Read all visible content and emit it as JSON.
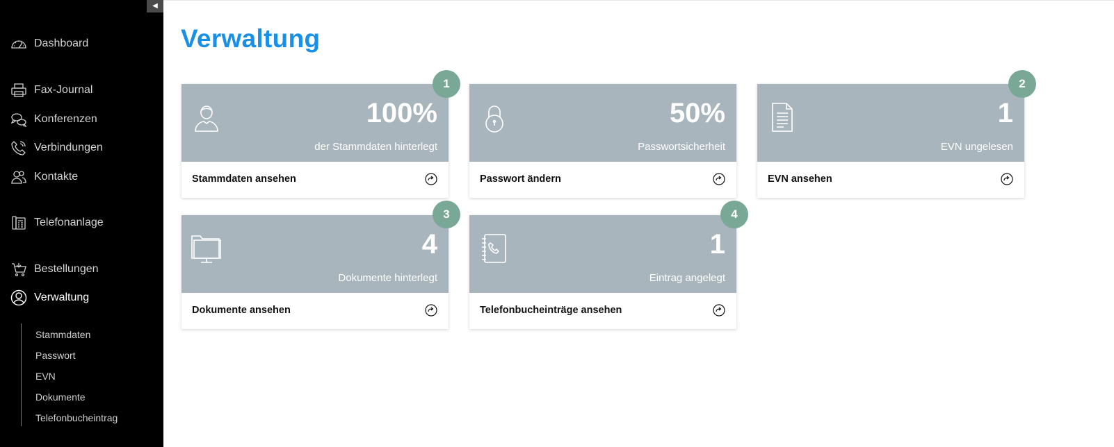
{
  "sidebar": {
    "collapse_glyph": "◀",
    "items": [
      {
        "label": "Dashboard",
        "icon": "speedometer-icon"
      },
      {
        "label": "Fax-Journal",
        "icon": "printer-icon"
      },
      {
        "label": "Konferenzen",
        "icon": "chat-bubbles-icon"
      },
      {
        "label": "Verbindungen",
        "icon": "phone-icon"
      },
      {
        "label": "Kontakte",
        "icon": "people-icon"
      },
      {
        "label": "Telefonanlage",
        "icon": "desk-phone-icon"
      },
      {
        "label": "Bestellungen",
        "icon": "cart-icon"
      },
      {
        "label": "Verwaltung",
        "icon": "user-circle-icon",
        "active": true
      }
    ],
    "subitems": [
      {
        "label": "Stammdaten"
      },
      {
        "label": "Passwort"
      },
      {
        "label": "EVN"
      },
      {
        "label": "Dokumente"
      },
      {
        "label": "Telefonbucheintrag"
      }
    ]
  },
  "main": {
    "title": "Verwaltung",
    "cards": [
      {
        "value": "100%",
        "desc": "der Stammdaten hinterlegt",
        "link": "Stammdaten ansehen",
        "badge": "1",
        "icon": "person-icon"
      },
      {
        "value": "50%",
        "desc": "Passwortsicherheit",
        "link": "Passwort ändern",
        "badge": "",
        "icon": "padlock-icon"
      },
      {
        "value": "1",
        "desc": "EVN ungelesen",
        "link": "EVN ansehen",
        "badge": "2",
        "icon": "document-icon"
      },
      {
        "value": "4",
        "desc": "Dokumente hinterlegt",
        "link": "Dokumente ansehen",
        "badge": "3",
        "icon": "folder-monitor-icon"
      },
      {
        "value": "1",
        "desc": "Eintrag angelegt",
        "link": "Telefonbucheinträge ansehen",
        "badge": "4",
        "icon": "phonebook-icon"
      }
    ]
  },
  "colors": {
    "sidebar_bg": "#000000",
    "title": "#1890e8",
    "card_top": "#a9b5bd",
    "badge": "#79a897"
  }
}
